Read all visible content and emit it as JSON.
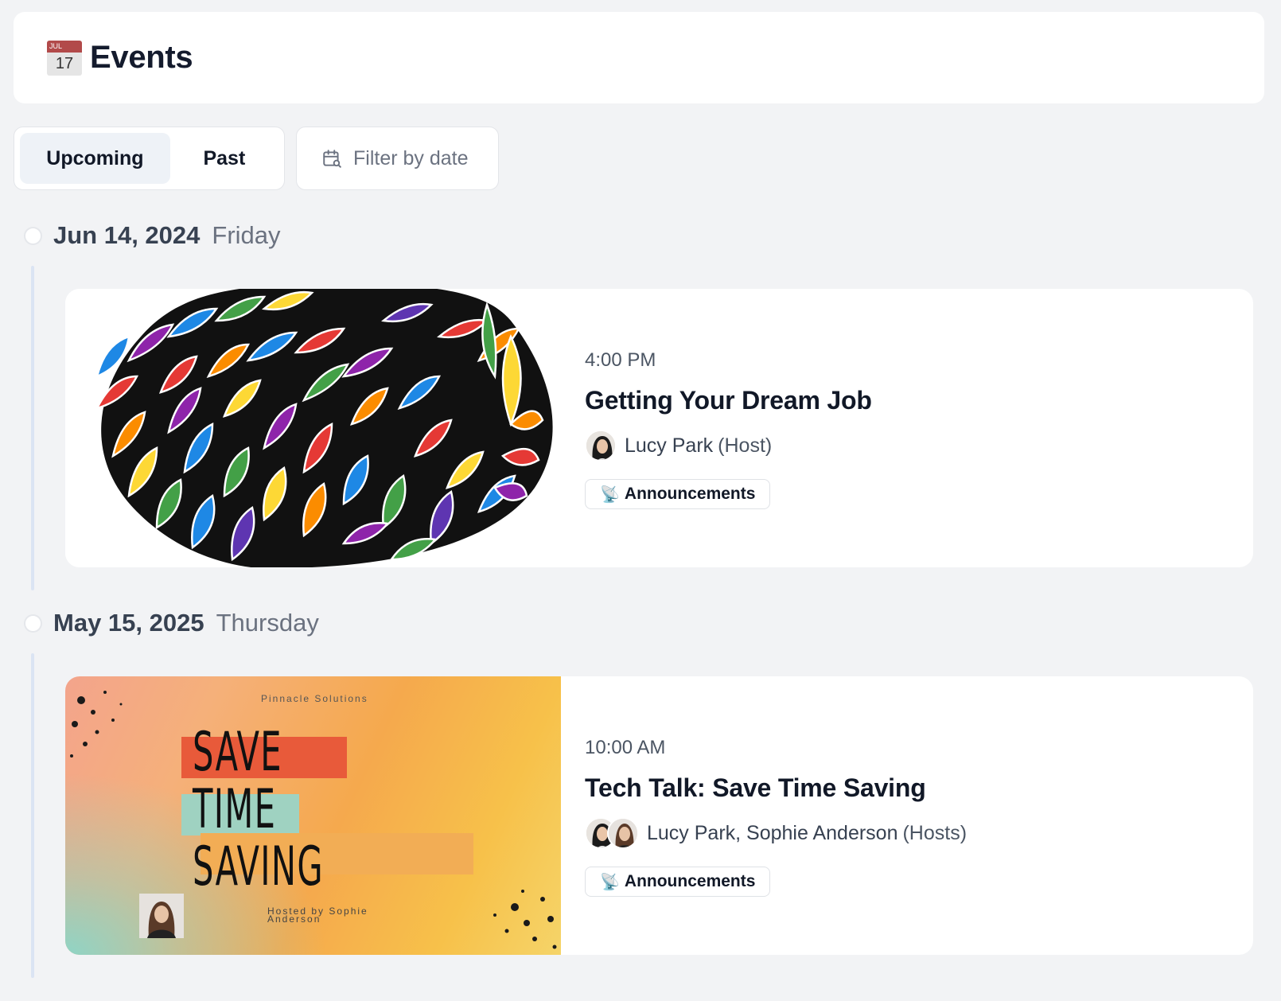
{
  "header": {
    "icon": "calendar-icon",
    "calendar_month": "JUL",
    "calendar_day": "17",
    "title": "Events"
  },
  "tabs": {
    "upcoming": "Upcoming",
    "past": "Past",
    "active": "Upcoming"
  },
  "filter": {
    "icon": "calendar-search-icon",
    "label": "Filter by date"
  },
  "groups": [
    {
      "date": "Jun 14, 2024",
      "weekday": "Friday",
      "events": [
        {
          "time": "4:00 PM",
          "title": "Getting Your Dream Job",
          "hosts": "Lucy Park",
          "role": "(Host)",
          "tag": "Announcements",
          "tag_icon": "satellite-dish-icon"
        }
      ]
    },
    {
      "date": "May 15, 2025",
      "weekday": "Thursday",
      "events": [
        {
          "time": "10:00 AM",
          "title": "Tech Talk: Save Time Saving",
          "hosts": "Lucy Park, Sophie Anderson",
          "role": "(Hosts)",
          "tag": "Announcements",
          "tag_icon": "satellite-dish-icon",
          "cover": {
            "org": "Pinnacle Solutions",
            "line1": "SAVE",
            "line2": "TIME",
            "line3": "SAVING",
            "hosted_by": "Hosted by Sophie Anderson"
          }
        }
      ]
    }
  ],
  "colors": {
    "background": "#f2f3f5",
    "card": "#ffffff",
    "active_tab": "#eef2f7",
    "timeline_rail": "#dbe4f3"
  }
}
